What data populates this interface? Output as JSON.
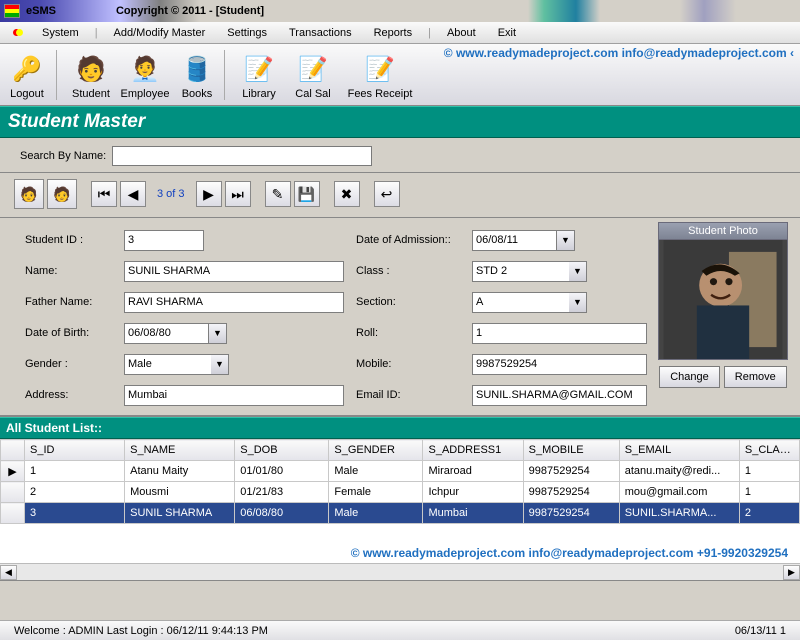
{
  "title_bar": {
    "app": "eSMS",
    "copy": "Copyright ©  2011 - [Student]"
  },
  "menu": {
    "items": [
      "System",
      "Add/Modify Master",
      "Settings",
      "Transactions",
      "Reports",
      "About",
      "Exit"
    ]
  },
  "toolbar": {
    "logout": "Logout",
    "student": "Student",
    "employee": "Employee",
    "books": "Books",
    "library": "Library",
    "calsal": "Cal Sal",
    "fees": "Fees Receipt"
  },
  "watermark1": "©  www.readymadeproject.com  info@readymadeproject.com  ‹",
  "page_title": "Student Master",
  "search": {
    "label": "Search By Name:",
    "value": ""
  },
  "recnav": {
    "counter": "3 of 3"
  },
  "form": {
    "labels": {
      "sid": "Student ID :",
      "name": "Name:",
      "father": "Father Name:",
      "dob": "Date of Birth:",
      "gender": "Gender :",
      "address": "Address:",
      "doa": "Date of Admission::",
      "class": "Class :",
      "section": "Section:",
      "roll": "Roll:",
      "mobile": "Mobile:",
      "email": "Email ID:"
    },
    "values": {
      "sid": "3",
      "name": "SUNIL SHARMA",
      "father": "RAVI SHARMA",
      "dob": "06/08/80",
      "gender": "Male",
      "address": "Mumbai",
      "doa": "06/08/11",
      "class": "STD 2",
      "section": "A",
      "roll": "1",
      "mobile": "9987529254",
      "email": "SUNIL.SHARMA@GMAIL.COM"
    },
    "photo_head": "Student Photo",
    "btn_change": "Change",
    "btn_remove": "Remove"
  },
  "list_head": "All Student List::",
  "grid": {
    "cols": [
      "S_ID",
      "S_NAME",
      "S_DOB",
      "S_GENDER",
      "S_ADDRESS1",
      "S_MOBILE",
      "S_EMAIL",
      "S_CLASS"
    ],
    "rows": [
      {
        "sel": false,
        "ptr": true,
        "c": [
          "1",
          "Atanu Maity",
          "01/01/80",
          "Male",
          "Miraroad",
          "9987529254",
          "atanu.maity@redi...",
          "1"
        ]
      },
      {
        "sel": false,
        "ptr": false,
        "c": [
          "2",
          "Mousmi",
          "01/21/83",
          "Female",
          "Ichpur",
          "9987529254",
          "mou@gmail.com",
          "1"
        ]
      },
      {
        "sel": true,
        "ptr": false,
        "c": [
          "3",
          "SUNIL SHARMA",
          "06/08/80",
          "Male",
          "Mumbai",
          "9987529254",
          "SUNIL.SHARMA...",
          "2"
        ]
      }
    ]
  },
  "watermark2": "©  www.readymadeproject.com  info@readymadeproject.com  +91-9920329254",
  "status": {
    "left": "Welcome : ADMIN  Last Login : 06/12/11 9:44:13 PM",
    "right": "06/13/11 1"
  }
}
